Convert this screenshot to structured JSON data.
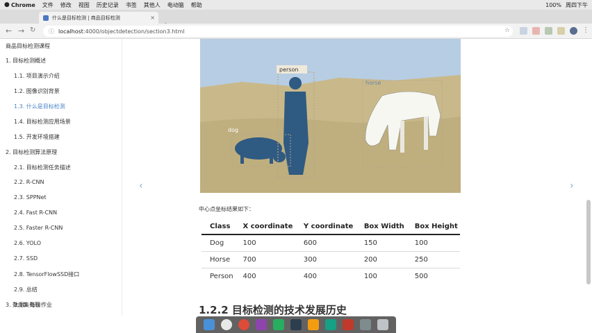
{
  "menubar": {
    "items": [
      "Chrome",
      "文件",
      "修改",
      "视图",
      "历史记录",
      "书签",
      "其他人",
      "电动脑",
      "帮助"
    ],
    "right": [
      "100%",
      "周四下午"
    ]
  },
  "browser": {
    "tab_title": "什么是目标检测 | 商品目标检测",
    "url_host": "localhost",
    "url_path": ":4000/objectdetection/section3.html"
  },
  "sidebar": {
    "title": "商品目标检测课程",
    "items": [
      {
        "label": "1. 目标检测概述",
        "level": 0
      },
      {
        "label": "1.1. 项目演示介绍",
        "level": 1
      },
      {
        "label": "1.2. 图像识别背景",
        "level": 1
      },
      {
        "label": "1.3. 什么是目标检测",
        "level": 1,
        "active": true
      },
      {
        "label": "1.4. 目标检测应用场景",
        "level": 1
      },
      {
        "label": "1.5. 开发环境搭建",
        "level": 1
      },
      {
        "label": "2. 目标检测算法原理",
        "level": 0
      },
      {
        "label": "2.1. 目标检测任务描述",
        "level": 1
      },
      {
        "label": "2.2. R-CNN",
        "level": 1
      },
      {
        "label": "2.3. SPPNet",
        "level": 1
      },
      {
        "label": "2.4. Fast R-CNN",
        "level": 1
      },
      {
        "label": "2.5. Faster R-CNN",
        "level": 1
      },
      {
        "label": "2.6. YOLO",
        "level": 1
      },
      {
        "label": "2.7. SSD",
        "level": 1
      },
      {
        "label": "2.8. TensorFlowSSD接口",
        "level": 1
      },
      {
        "label": "2.9. 总结",
        "level": 1
      },
      {
        "label": "2.10. 每日作业",
        "level": 1
      },
      {
        "label": "3. 数据集处理",
        "level": 0
      }
    ]
  },
  "figure": {
    "labels": {
      "person": "person",
      "dog": "dog",
      "horse": "horse"
    }
  },
  "content": {
    "intro": "中心点坐标结果如下：",
    "table": {
      "headers": [
        "Class",
        "X coordinate",
        "Y coordinate",
        "Box Width",
        "Box Height"
      ],
      "rows": [
        [
          "Dog",
          "100",
          "600",
          "150",
          "100"
        ],
        [
          "Horse",
          "700",
          "300",
          "200",
          "250"
        ],
        [
          "Person",
          "400",
          "400",
          "100",
          "500"
        ]
      ]
    },
    "next_section": "1.2.2 目标检测的技术发展历史"
  },
  "nav": {
    "prev_arrow": "‹",
    "next_arrow": "›"
  },
  "colors": {
    "accent": "#4a85c8",
    "sky": "#b7cde3",
    "ground": "#c9b98a",
    "shadow": "#2f5a82"
  }
}
